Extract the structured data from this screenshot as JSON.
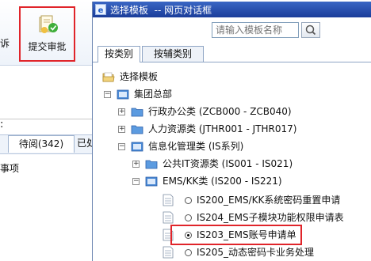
{
  "background_app": {
    "left_label": "诉",
    "submit_button_label": "提交审批",
    "colon": ":",
    "tab_pending": "待阅(342)",
    "tab_done": "已处",
    "list_item": "事项"
  },
  "dialog": {
    "title": "选择模板  -- 网页对话框",
    "search_placeholder": "请输入模板名称",
    "tabs": [
      {
        "label": "按类别"
      },
      {
        "label": "按辅类别"
      }
    ],
    "tree": {
      "root": "选择模板",
      "group": "集团总部",
      "cat_admin": "行政办公类 (ZCB000 - ZCB040)",
      "cat_hr": "人力资源类 (JTHR001 - JTHR017)",
      "cat_it": "信息化管理类 (IS系列)",
      "sub_public": "公共IT资源类 (IS001 - IS021)",
      "sub_ems": "EMS/KK类 (IS200 - IS221)",
      "items": [
        {
          "label": "IS200_EMS/KK系统密码重置申请",
          "selected": false
        },
        {
          "label": "IS204_EMS子模块功能权限申请表",
          "selected": false
        },
        {
          "label": "IS203_EMS账号申请单",
          "selected": true
        },
        {
          "label": "IS205_动态密码卡业务处理",
          "selected": false
        }
      ]
    }
  },
  "colors": {
    "highlight_border": "#e0242a",
    "titlebar": "#1a3d9a",
    "folder_blue": "#4a8ad6"
  }
}
